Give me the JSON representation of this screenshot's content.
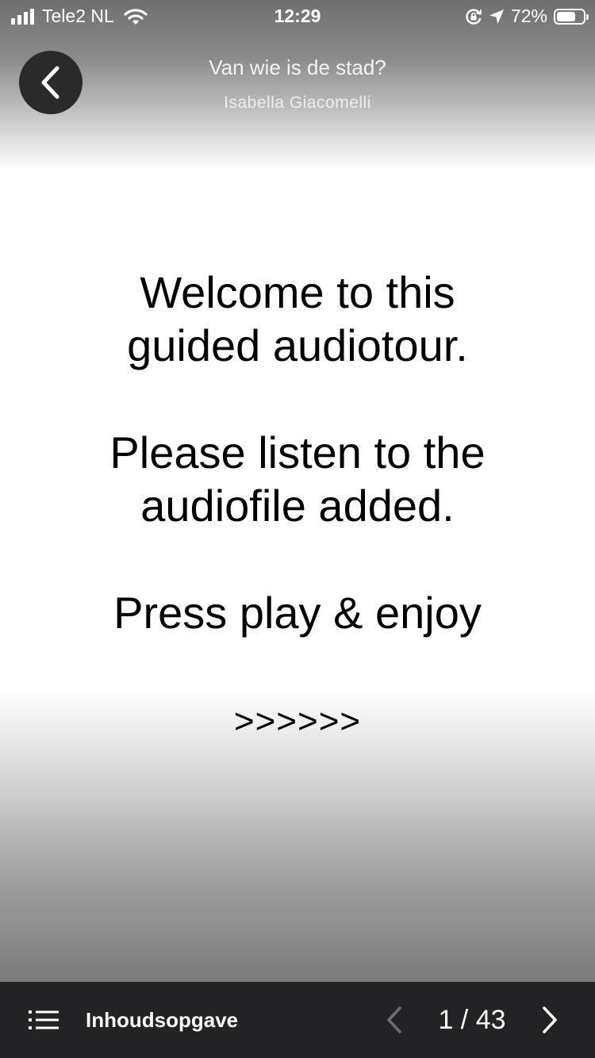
{
  "status_bar": {
    "carrier": "Tele2 NL",
    "time": "12:29",
    "battery_percent": "72%",
    "battery_level": 0.72,
    "icons": [
      "signal-icon",
      "wifi-icon",
      "orientation-lock-icon",
      "location-arrow-icon",
      "battery-icon"
    ]
  },
  "header": {
    "title": "Van wie is de stad?",
    "subtitle": "Isabella Giacomelli",
    "back_icon": "chevron-left-icon"
  },
  "slide": {
    "line1": "Welcome to this",
    "line2": "guided audiotour.",
    "line3": "Please listen to the",
    "line4": "audiofile added.",
    "line5": "Press play & enjoy",
    "line6": ">>>>>>"
  },
  "toolbar": {
    "toc_icon": "list-icon",
    "toc_label": "Inhoudsopgave",
    "prev_icon": "chevron-left-icon",
    "page_counter": "1 / 43",
    "next_icon": "chevron-right-icon"
  },
  "colors": {
    "toolbar_background": "#232325",
    "back_button_background": "#2a2a2a",
    "text_primary": "#000000",
    "text_light": "#ffffff"
  }
}
